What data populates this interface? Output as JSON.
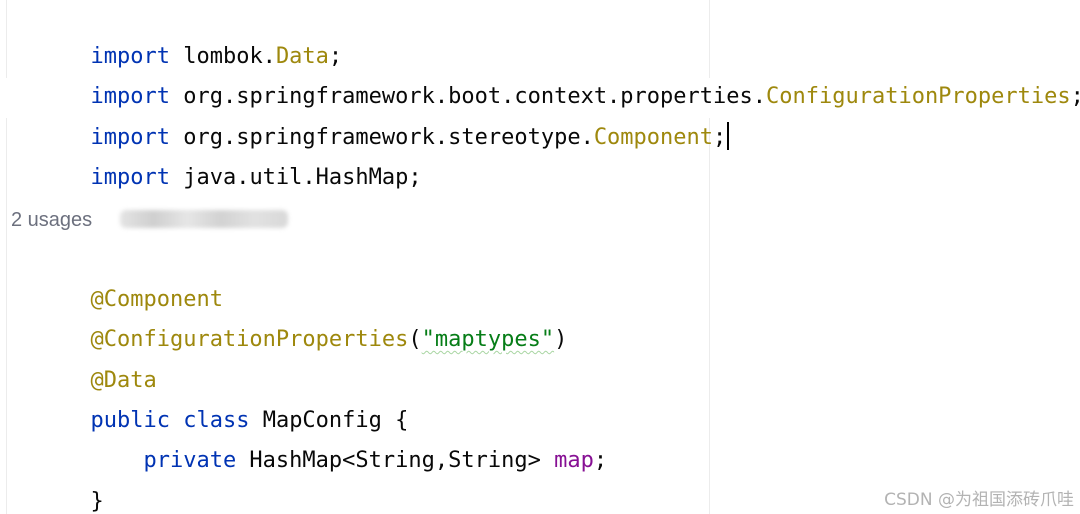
{
  "editor": {
    "lines": [
      {
        "tokens": [
          {
            "text": "import",
            "kind": "kw"
          },
          {
            "text": " lombok.",
            "kind": "plain"
          },
          {
            "text": "Data",
            "kind": "imp"
          },
          {
            "text": ";",
            "kind": "plain"
          }
        ]
      },
      {
        "tokens": [
          {
            "text": "import",
            "kind": "kw"
          },
          {
            "text": " org.springframework.boot.context.properties.",
            "kind": "plain"
          },
          {
            "text": "ConfigurationProperties",
            "kind": "imp"
          },
          {
            "text": ";",
            "kind": "plain"
          }
        ]
      },
      {
        "tokens": [
          {
            "text": "import",
            "kind": "kw"
          },
          {
            "text": " org.springframework.stereotype.",
            "kind": "plain"
          },
          {
            "text": "Component",
            "kind": "imp"
          },
          {
            "text": ";",
            "kind": "plain"
          }
        ]
      },
      {
        "tokens": [
          {
            "text": "import",
            "kind": "kw"
          },
          {
            "text": " java.util.HashMap;",
            "kind": "plain"
          }
        ]
      },
      {
        "tokens": [
          {
            "text": "@Component",
            "kind": "ann"
          }
        ]
      },
      {
        "tokens": [
          {
            "text": "@ConfigurationProperties",
            "kind": "ann"
          },
          {
            "text": "(",
            "kind": "plain"
          },
          {
            "text": "\"maptypes\"",
            "kind": "str"
          },
          {
            "text": ")",
            "kind": "plain"
          }
        ]
      },
      {
        "tokens": [
          {
            "text": "@Data",
            "kind": "ann"
          }
        ]
      },
      {
        "tokens": [
          {
            "text": "public",
            "kind": "kw"
          },
          {
            "text": " ",
            "kind": "plain"
          },
          {
            "text": "class",
            "kind": "kw"
          },
          {
            "text": " MapConfig {",
            "kind": "plain"
          }
        ]
      },
      {
        "tokens": [
          {
            "text": "    ",
            "kind": "plain"
          },
          {
            "text": "private",
            "kind": "kw"
          },
          {
            "text": " HashMap<String,String> ",
            "kind": "plain"
          },
          {
            "text": "map",
            "kind": "field"
          },
          {
            "text": ";",
            "kind": "plain"
          }
        ]
      },
      {
        "tokens": [
          {
            "text": "}",
            "kind": "plain"
          }
        ]
      }
    ],
    "usages_hint": "2 usages",
    "caret_line": 3
  },
  "watermark": "CSDN @为祖国添砖爪哇",
  "colors": {
    "keyword": "#0033b3",
    "annotation": "#9e880d",
    "string": "#067d17",
    "field": "#871094",
    "text": "#080808",
    "hint": "#6c707e",
    "watermark": "#b3b3b3"
  }
}
